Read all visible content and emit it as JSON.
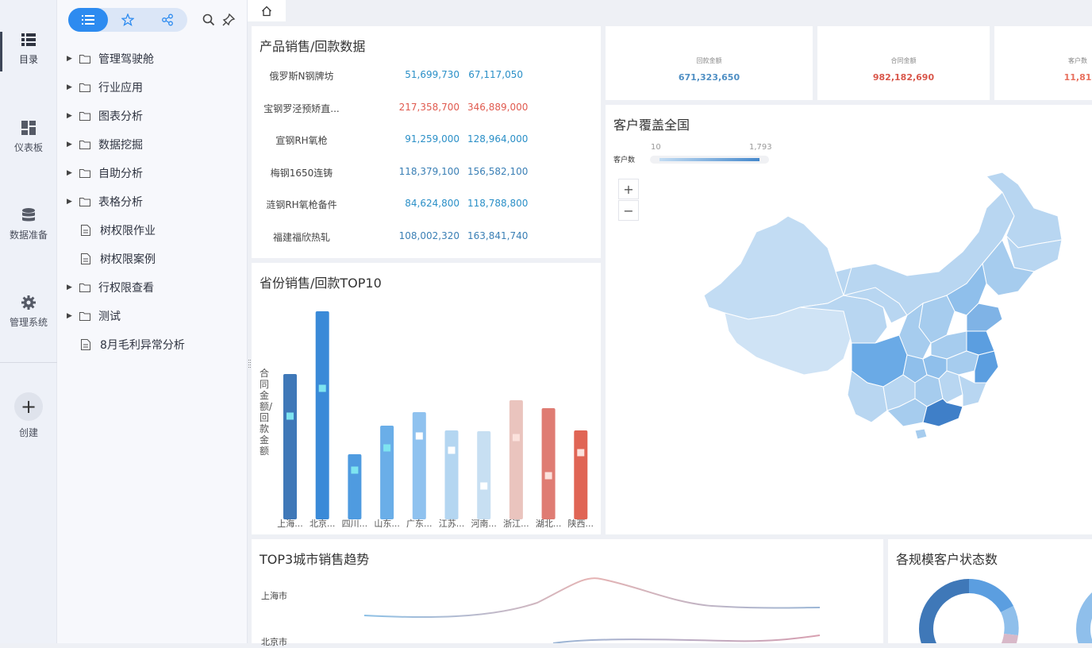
{
  "rail": {
    "items": [
      {
        "label": "目录",
        "icon": "list-icon"
      },
      {
        "label": "仪表板",
        "icon": "dashboard-icon"
      },
      {
        "label": "数据准备",
        "icon": "database-icon"
      },
      {
        "label": "管理系统",
        "icon": "gear-icon"
      }
    ],
    "create_label": "创建"
  },
  "tree": {
    "items": [
      {
        "label": "管理驾驶舱",
        "type": "folder"
      },
      {
        "label": "行业应用",
        "type": "folder"
      },
      {
        "label": "图表分析",
        "type": "folder"
      },
      {
        "label": "数据挖掘",
        "type": "folder"
      },
      {
        "label": "自助分析",
        "type": "folder"
      },
      {
        "label": "表格分析",
        "type": "folder"
      },
      {
        "label": "树权限作业",
        "type": "doc"
      },
      {
        "label": "树权限案例",
        "type": "doc"
      },
      {
        "label": "行权限查看",
        "type": "folder"
      },
      {
        "label": "测试",
        "type": "folder"
      },
      {
        "label": "8月毛利异常分析",
        "type": "doc"
      }
    ]
  },
  "product": {
    "title": "产品销售/回款数据",
    "rows": [
      {
        "name": "俄罗斯N钢牌坊",
        "v1": "51,699,730",
        "v2": "67,117,050",
        "color": "#2a8fc7"
      },
      {
        "name": "宝钢罗泾预矫直...",
        "v1": "217,358,700",
        "v2": "346,889,000",
        "color": "#e05a4f"
      },
      {
        "name": "宣钢RH氧枪",
        "v1": "91,259,000",
        "v2": "128,964,000",
        "color": "#2a8fc7"
      },
      {
        "name": "梅钢1650连铸",
        "v1": "118,379,100",
        "v2": "156,582,100",
        "color": "#3a7fb5"
      },
      {
        "name": "涟钢RH氧枪备件",
        "v1": "84,624,800",
        "v2": "118,788,800",
        "color": "#2a8fc7"
      },
      {
        "name": "福建福欣热轧",
        "v1": "108,002,320",
        "v2": "163,841,740",
        "color": "#3a7fb5"
      }
    ]
  },
  "kpis": [
    {
      "label": "回款金额",
      "value": "671,323,650",
      "color": "#4f8fc4"
    },
    {
      "label": "合同金额",
      "value": "982,182,690",
      "color": "#d9574b"
    },
    {
      "label": "客户数",
      "value": "11,81",
      "color": "#e8705e"
    }
  ],
  "province": {
    "title": "省份销售/回款TOP10",
    "ylabel": "合同金额/回款金额"
  },
  "chart_data": {
    "type": "bar",
    "categories": [
      "上海...",
      "北京...",
      "四川...",
      "山东...",
      "广东...",
      "江苏...",
      "河南...",
      "浙江...",
      "湖北...",
      "陕西..."
    ],
    "series": [
      {
        "values": [
          183,
          262,
          82,
          118,
          135,
          112,
          111,
          150,
          140,
          112
        ]
      },
      {
        "values": [
          130,
          165,
          62,
          90,
          105,
          87,
          42,
          103,
          55,
          84
        ]
      }
    ],
    "colors": [
      "#3f78b8",
      "#3a8ad8",
      "#4f9be0",
      "#6aaee8",
      "#8fc2ef",
      "#b4d6f1",
      "#c7dff2",
      "#eac4be",
      "#df7c73",
      "#e06555"
    ],
    "ylim": [
      0,
      270
    ]
  },
  "map": {
    "title": "客户覆盖全国",
    "legend_name": "客户数",
    "legend_min": "10",
    "legend_max": "1,793",
    "zoom_in": "+",
    "zoom_out": "−"
  },
  "trend": {
    "title": "TOP3城市销售趋势",
    "cities": [
      "上海市",
      "北京市"
    ]
  },
  "status": {
    "title": "各规模客户状态数"
  }
}
